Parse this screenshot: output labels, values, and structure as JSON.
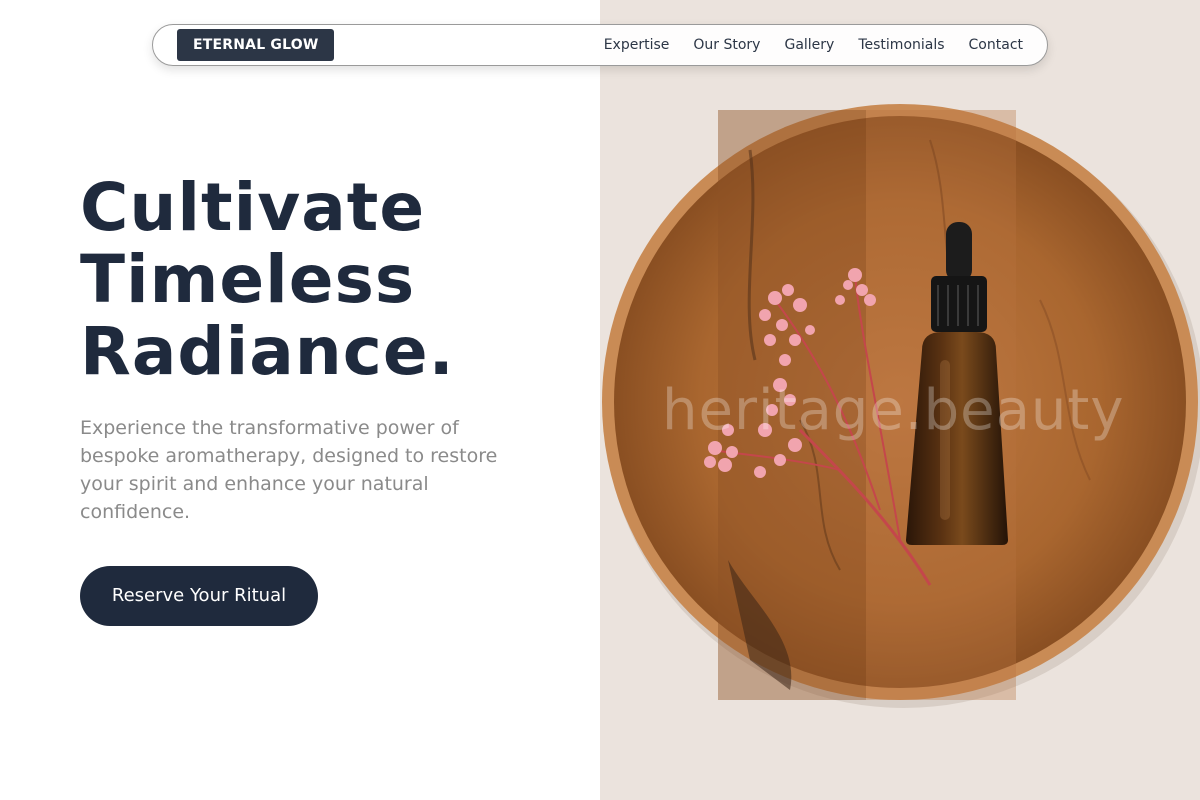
{
  "nav": {
    "brand": "ETERNAL GLOW",
    "links": [
      "Expertise",
      "Our Story",
      "Gallery",
      "Testimonials",
      "Contact"
    ]
  },
  "hero": {
    "title_lines": [
      "Cultivate",
      "Timeless",
      "Radiance."
    ],
    "subtitle": "Experience the transformative power of bespoke aromatherapy, designed to restore your spirit and enhance your natural confidence.",
    "cta_label": "Reserve Your Ritual"
  },
  "image": {
    "watermark": "heritage.beauty"
  },
  "colors": {
    "primary": "#1f2a3d",
    "brand_bg": "#2c3646",
    "muted_text": "#8a8a8a",
    "backdrop": "#ebe3dd",
    "wood": "#b9753f"
  }
}
